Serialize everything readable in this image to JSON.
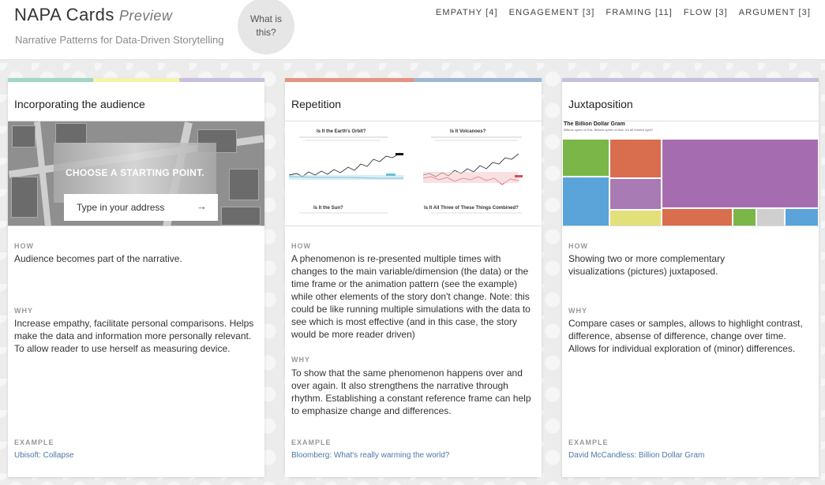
{
  "header": {
    "title": "NAPA Cards",
    "title_suffix": "Preview",
    "subtitle": "Narrative Patterns for Data-Driven Storytelling",
    "about_button": "What is this?"
  },
  "nav": [
    {
      "label": "EMPATHY [4]"
    },
    {
      "label": "ENGAGEMENT [3]"
    },
    {
      "label": "FRAMING [11]"
    },
    {
      "label": "FLOW [3]"
    },
    {
      "label": "ARGUMENT [3]"
    }
  ],
  "colors": {
    "teal": "#9fd7c7",
    "yellow": "#f6f3a9",
    "lavender": "#c9bfdd",
    "coral": "#e49382",
    "blue": "#9fb6d6",
    "link": "#4b78a8"
  },
  "labels": {
    "how": "HOW",
    "why": "WHY",
    "example": "EXAMPLE"
  },
  "cards": [
    {
      "title": "Incorporating the audience",
      "how": "Audience becomes part of the narrative.",
      "why": "Increase empathy, facilitate personal comparisons. Helps make the data and information more personally relevant. To allow reader to use herself as measuring device.",
      "example": "Ubisoft: Collapse",
      "image": {
        "heading": "CHOOSE A STARTING POINT.",
        "input_placeholder": "Type in your address",
        "arrow": "→"
      }
    },
    {
      "title": "Repetition",
      "how": "A phenomenon is re-presented multiple times with changes to the main variable/dimension (the data) or the time frame or the animation pattern (see the example) while other elements of the story don't change. Note: this could be like running multiple simulations with the data to see which is most effective (and in this case, the story would be more reader driven)",
      "why": "To show that the same phenomenon happens over and over again. It also strengthens the narrative through rhythm. Establishing a constant reference frame can help to emphasize change and differences.",
      "example": "Bloomberg: What's really warming the world?",
      "image": {
        "panel_titles": [
          "Is It the Earth's Orbit?",
          "Is It Volcanoes?",
          "Is It the Sun?",
          "Is It All Three of These Things Combined?"
        ]
      }
    },
    {
      "title": "Juxtaposition",
      "how": "Showing two or more complementary visualizations (pictures) juxtaposed.",
      "why": "Compare cases or samples, allows to highlight contrast, difference, absense of difference, change over time. Allows for individual exploration of (minor) differences.",
      "example": "David McCandless: Billion Dollar Gram",
      "image": {
        "title": "The Billion Dollar Gram",
        "subtitle": "Billions spent on this. Billions spent on that. It's all relative right?"
      }
    }
  ]
}
